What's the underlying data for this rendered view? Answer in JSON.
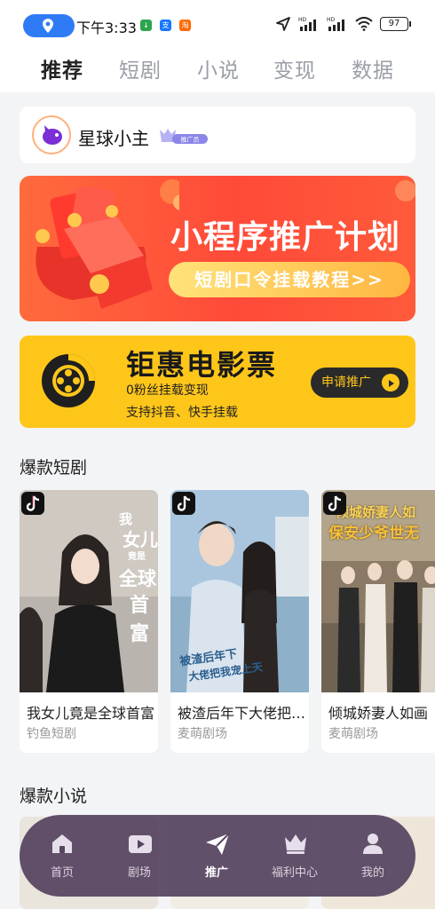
{
  "status_bar": {
    "time": "下午3:33",
    "app_icons": [
      "download-icon",
      "alipay-icon",
      "taobao-icon"
    ],
    "battery": "97",
    "network_labels": [
      "HD",
      "HD"
    ]
  },
  "top_tabs": [
    {
      "label": "推荐",
      "active": true
    },
    {
      "label": "短剧",
      "active": false
    },
    {
      "label": "小说",
      "active": false
    },
    {
      "label": "变现",
      "active": false
    },
    {
      "label": "数据",
      "active": false
    }
  ],
  "profile": {
    "name": "星球小主",
    "badge_text": "推广员"
  },
  "banner_promo": {
    "title": "小程序推广计划",
    "cta": "短剧口令挂载教程>>"
  },
  "banner_movie": {
    "title": "钜惠电影票",
    "line1": "0粉丝挂载变现",
    "line2": "支持抖音、快手挂载",
    "button": "申请推广"
  },
  "sections": {
    "dramas_title": "爆款短剧",
    "novels_title": "爆款小说"
  },
  "dramas": [
    {
      "title": "我女儿竟是全球首富",
      "source": "钓鱼短剧",
      "poster_text": [
        "我",
        "女儿",
        "竟是",
        "全球",
        "首富"
      ]
    },
    {
      "title": "被渣后年下大佬把我宠上天",
      "source": "麦萌剧场",
      "poster_text": [
        "被渣后年下",
        "大佬把我宠上天"
      ]
    },
    {
      "title": "倾城娇妻人如画",
      "source": "麦萌剧场",
      "poster_text": [
        "倾城娇妻人如",
        "保安少爷世无"
      ]
    }
  ],
  "bottom_nav": [
    {
      "label": "首页",
      "icon": "home-icon",
      "active": false
    },
    {
      "label": "剧场",
      "icon": "theater-icon",
      "active": false
    },
    {
      "label": "推广",
      "icon": "paper-plane-icon",
      "active": true
    },
    {
      "label": "福利中心",
      "icon": "crown-icon",
      "active": false
    },
    {
      "label": "我的",
      "icon": "user-icon",
      "active": false
    }
  ],
  "colors": {
    "accent_blue": "#2f7bf5",
    "banner_red": "#ff4a39",
    "banner_yellow": "#ffc61a",
    "nav_bg": "#564460"
  }
}
